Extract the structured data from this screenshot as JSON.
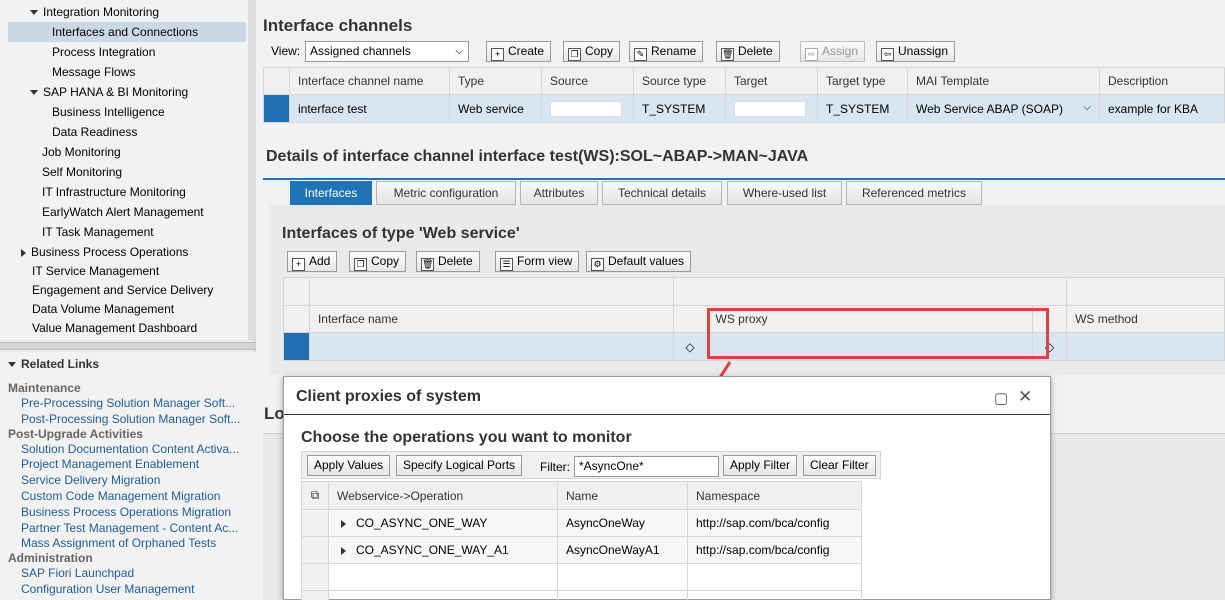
{
  "nav": {
    "tree": [
      {
        "label": "Integration Monitoring",
        "expanded": true
      },
      {
        "label": "Interfaces and Connections",
        "selected": true
      },
      {
        "label": "Process Integration"
      },
      {
        "label": "Message Flows"
      },
      {
        "label": "SAP HANA & BI Monitoring",
        "expanded": true
      },
      {
        "label": "Business Intelligence"
      },
      {
        "label": "Data Readiness"
      },
      {
        "label": "Job Monitoring"
      },
      {
        "label": "Self Monitoring"
      },
      {
        "label": "IT Infrastructure Monitoring"
      },
      {
        "label": "EarlyWatch Alert Management"
      },
      {
        "label": "IT Task Management"
      },
      {
        "label": "Business Process Operations",
        "expanded": false
      },
      {
        "label": "IT Service Management"
      },
      {
        "label": "Engagement and Service Delivery"
      },
      {
        "label": "Data Volume Management"
      },
      {
        "label": "Value Management Dashboard"
      }
    ],
    "related_links_title": "Related Links",
    "groups": [
      {
        "title": "Maintenance",
        "items": [
          "Pre-Processing Solution Manager Soft...",
          "Post-Processing Solution Manager Soft..."
        ]
      },
      {
        "title": "Post-Upgrade Activities",
        "items": [
          "Solution Documentation Content Activa...",
          "Project Management Enablement",
          "Service Delivery Migration",
          "Custom Code Management Migration",
          "Business Process Operations Migration",
          "Partner Test Management - Content Ac...",
          "Mass Assignment of Orphaned Tests"
        ]
      },
      {
        "title": "Administration",
        "items": [
          "SAP Fiori Launchpad",
          "Configuration User Management"
        ]
      }
    ]
  },
  "channels": {
    "title": "Interface channels",
    "view_label": "View:",
    "view_value": "Assigned channels",
    "buttons": {
      "create": "Create",
      "copy": "Copy",
      "rename": "Rename",
      "delete": "Delete",
      "assign": "Assign",
      "unassign": "Unassign"
    },
    "columns": [
      "Interface channel name",
      "Type",
      "Source",
      "Source type",
      "Target",
      "Target type",
      "MAI Template",
      "Description"
    ],
    "rows": [
      {
        "name": "interface test",
        "type": "Web service",
        "source": "",
        "source_type": "T_SYSTEM",
        "target": "",
        "target_type": "T_SYSTEM",
        "template": "Web Service ABAP (SOAP)",
        "description": "example for KBA"
      }
    ]
  },
  "details": {
    "title": "Details of interface channel interface test(WS):SOL~ABAP->MAN~JAVA",
    "tabs": [
      "Interfaces",
      "Metric configuration",
      "Attributes",
      "Technical details",
      "Where-used list",
      "Referenced metrics"
    ],
    "active_tab": "Interfaces",
    "sub_title": "Interfaces of type 'Web service'",
    "buttons": {
      "add": "Add",
      "copy": "Copy",
      "delete": "Delete",
      "form_view": "Form view",
      "default_values": "Default values"
    },
    "columns": [
      "Interface name",
      "WS proxy",
      "WS method"
    ],
    "behind_label": "Lo"
  },
  "dialog": {
    "title": "Client proxies of system",
    "subtitle": "Choose the operations you want to monitor",
    "buttons": {
      "apply_values": "Apply Values",
      "specify_ports": "Specify Logical Ports",
      "apply_filter": "Apply Filter",
      "clear_filter": "Clear Filter"
    },
    "filter_label": "Filter:",
    "filter_value": "*AsyncOne*",
    "columns": [
      "Webservice->Operation",
      "Name",
      "Namespace"
    ],
    "rows": [
      {
        "operation": "CO_ASYNC_ONE_WAY",
        "name": "AsyncOneWay",
        "namespace": "http://sap.com/bca/config"
      },
      {
        "operation": "CO_ASYNC_ONE_WAY_A1",
        "name": "AsyncOneWayA1",
        "namespace": "http://sap.com/bca/config"
      }
    ]
  },
  "colors": {
    "accent": "#1f73b7",
    "annotation": "#e04040",
    "selected_row": "#d8e6f2",
    "link": "#1f5d98"
  }
}
